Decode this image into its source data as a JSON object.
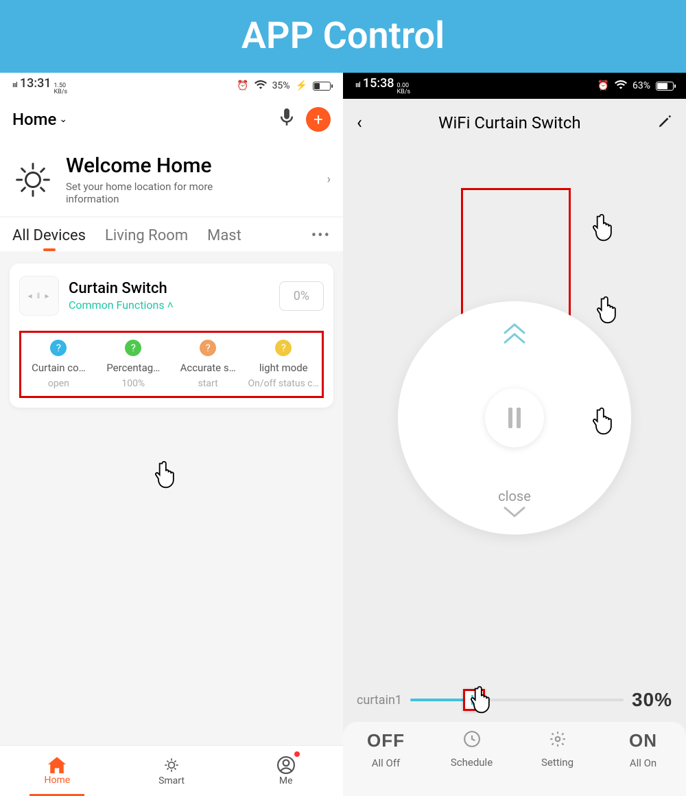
{
  "banner": {
    "title": "APP Control"
  },
  "left": {
    "status": {
      "signal": "4GHD",
      "time": "13:31",
      "kbs": "1.50",
      "kbs_unit": "KB/s",
      "battery": "35%",
      "charging": true
    },
    "topbar": {
      "home_label": "Home"
    },
    "welcome": {
      "title": "Welcome Home",
      "subtitle": "Set your home location for more information"
    },
    "tabs": [
      "All Devices",
      "Living Room",
      "Mast"
    ],
    "device": {
      "name": "Curtain Switch",
      "common_functions": "Common Functions",
      "percent": "0%"
    },
    "functions": [
      {
        "label": "Curtain co…",
        "value": "open",
        "color": "#35b6e6"
      },
      {
        "label": "Percentag…",
        "value": "100%",
        "color": "#4ec94e"
      },
      {
        "label": "Accurate s…",
        "value": "start",
        "color": "#f0a060"
      },
      {
        "label": "light mode",
        "value": "On/off status c…",
        "color": "#f2c83f"
      }
    ],
    "bottombar": [
      "Home",
      "Smart",
      "Me"
    ]
  },
  "right": {
    "status": {
      "signal": "4GHD",
      "time": "15:38",
      "kbs": "0.00",
      "kbs_unit": "KB/s",
      "battery": "63%"
    },
    "title": "WiFi Curtain Switch",
    "wheel": {
      "close_label": "close"
    },
    "slider": {
      "label": "curtain1",
      "percent": "30%"
    },
    "actions": [
      {
        "big": "OFF",
        "label": "All Off"
      },
      {
        "icon": "clock",
        "label": "Schedule"
      },
      {
        "icon": "gear",
        "label": "Setting"
      },
      {
        "big": "ON",
        "label": "All On"
      }
    ]
  }
}
